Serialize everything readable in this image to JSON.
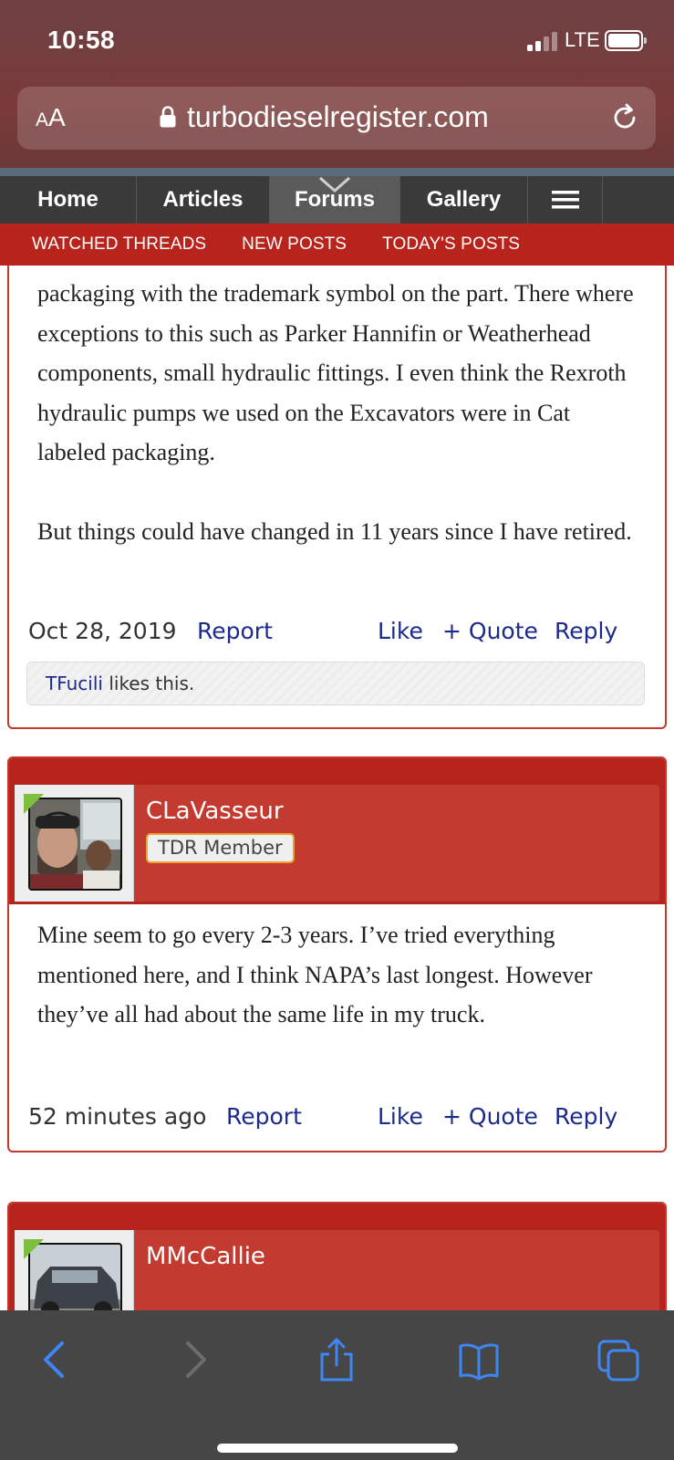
{
  "status_bar": {
    "time": "10:58",
    "network": "LTE"
  },
  "browser": {
    "text_size_button": "AA",
    "url": "turbodieselregister.com"
  },
  "nav": {
    "items": [
      "Home",
      "Articles",
      "Forums",
      "Gallery"
    ],
    "active": "Forums",
    "menu_icon": "hamburger-menu-icon"
  },
  "sub_nav": {
    "items": [
      "WATCHED THREADS",
      "NEW POSTS",
      "TODAY'S POSTS"
    ]
  },
  "posts": [
    {
      "body_paragraphs": [
        "packaging with the trademark symbol on the part. There where exceptions to this such as Parker Hannifin or Weatherhead components, small hydraulic fittings. I even think the Rexroth hydraulic pumps we used on the Excavators were in Cat labeled packaging.",
        "But things could have changed in 11 years since I have retired."
      ],
      "date": "Oct 28, 2019",
      "report_label": "Report",
      "like_label": "Like",
      "quote_label": "+ Quote",
      "reply_label": "Reply",
      "likes": {
        "who": "TFucili",
        "suffix": "likes this."
      }
    },
    {
      "username": "CLaVasseur",
      "badge": "TDR Member",
      "body_paragraphs": [
        "Mine seem to go every 2-3 years. I’ve tried everything mentioned here, and I think NAPA’s last longest. However they’ve all had about the same life in my truck."
      ],
      "date": "52 minutes ago",
      "report_label": "Report",
      "like_label": "Like",
      "quote_label": "+ Quote",
      "reply_label": "Reply"
    },
    {
      "username": "MMcCallie"
    }
  ],
  "colors": {
    "brand_red": "#b8241c",
    "link_blue": "#1b2a8c",
    "online_green": "#7fbf3f"
  }
}
